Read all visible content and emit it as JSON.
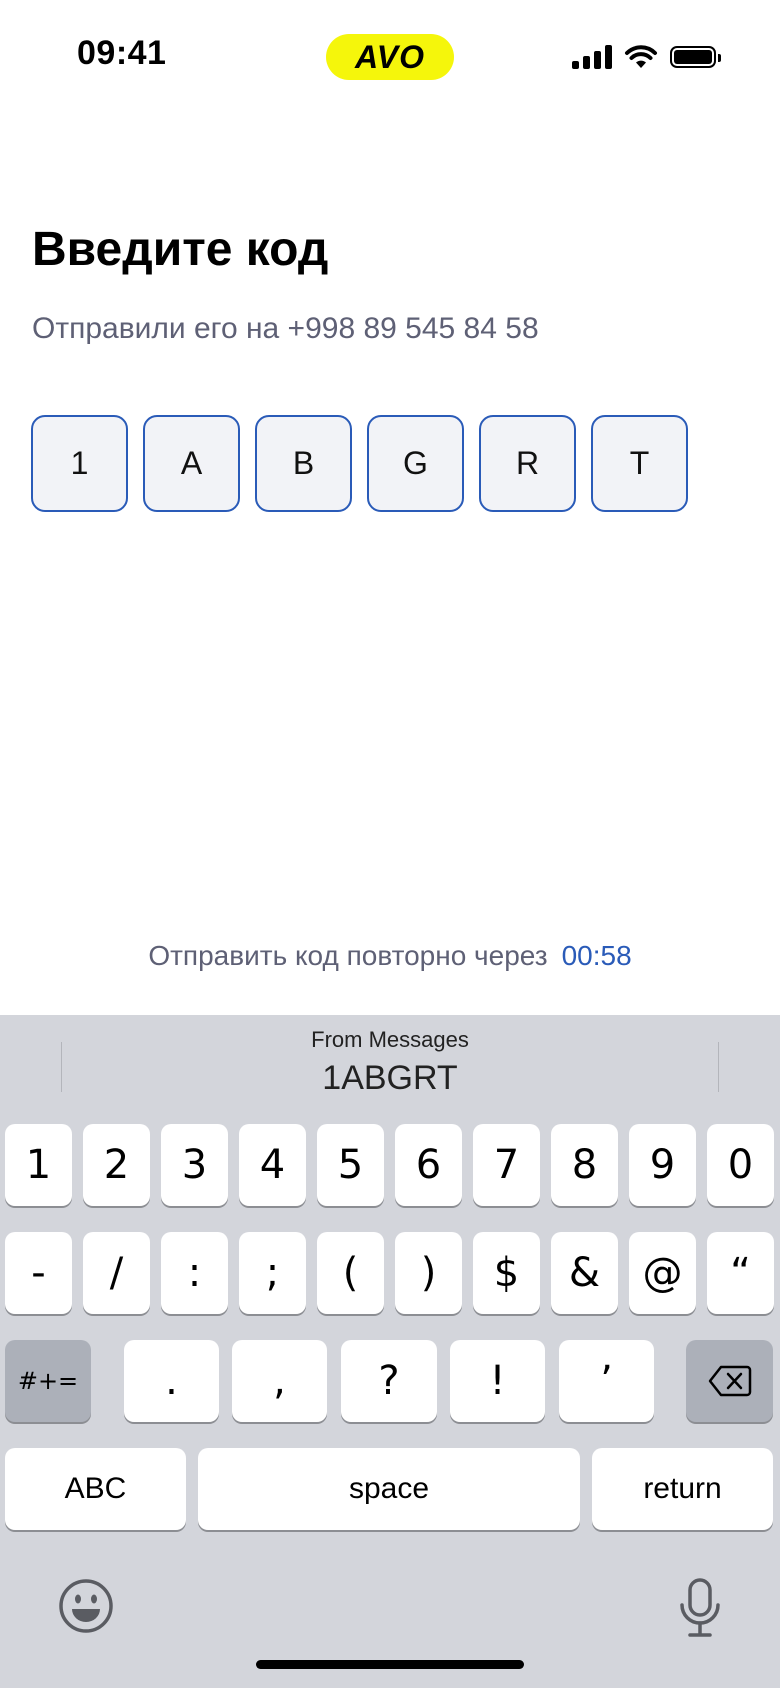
{
  "status_bar": {
    "time": "09:41",
    "brand": "AVO"
  },
  "screen": {
    "title": "Введите код",
    "subtitle": "Отправили его на +998 89 545 84 58",
    "code_cells": [
      "1",
      "A",
      "B",
      "G",
      "R",
      "T"
    ],
    "resend_label": "Отправить код повторно через",
    "resend_timer": "00:58"
  },
  "keyboard": {
    "suggestion_source": "From Messages",
    "suggestion_code": "1ABGRT",
    "row1": [
      "1",
      "2",
      "3",
      "4",
      "5",
      "6",
      "7",
      "8",
      "9",
      "0"
    ],
    "row2": [
      "-",
      "/",
      ":",
      ";",
      "(",
      ")",
      "$",
      "&",
      "@",
      "“"
    ],
    "symbols_key": "#+=",
    "row3": [
      ".",
      ",",
      "?",
      "!",
      "’"
    ],
    "abc_key": "ABC",
    "space_key": "space",
    "return_key": "return",
    "icons": [
      "delete-icon",
      "emoji-icon",
      "microphone-icon",
      "wifi-icon",
      "signal-icon",
      "battery-icon"
    ]
  }
}
